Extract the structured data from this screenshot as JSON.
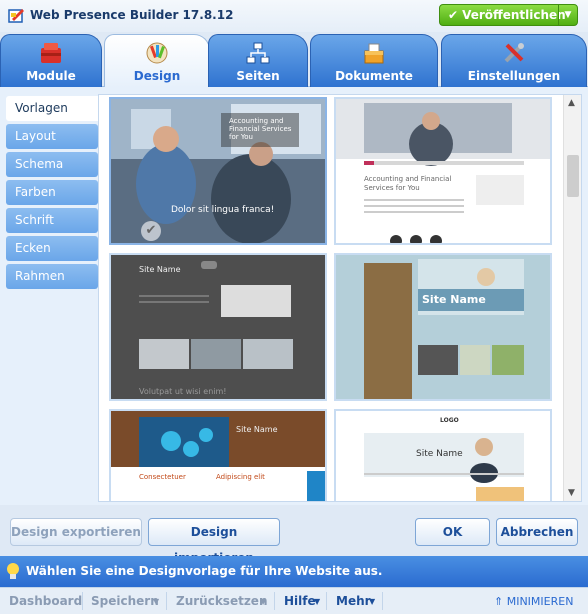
{
  "app": {
    "title": "Web Presence Builder 17.8.12",
    "publish_label": "Veröffentlichen"
  },
  "tabs": [
    {
      "label": "Module",
      "icon": "module-icon",
      "active": false
    },
    {
      "label": "Design",
      "icon": "design-icon",
      "active": true
    },
    {
      "label": "Seiten",
      "icon": "pages-icon",
      "active": false
    },
    {
      "label": "Dokumente",
      "icon": "documents-icon",
      "active": false
    },
    {
      "label": "Einstellungen",
      "icon": "settings-icon",
      "active": false
    }
  ],
  "sidebar": {
    "items": [
      {
        "label": "Vorlagen",
        "active": true
      },
      {
        "label": "Layout",
        "active": false
      },
      {
        "label": "Schema",
        "active": false
      },
      {
        "label": "Farben",
        "active": false
      },
      {
        "label": "Schrift",
        "active": false
      },
      {
        "label": "Ecken",
        "active": false
      },
      {
        "label": "Rahmen",
        "active": false
      }
    ]
  },
  "templates": [
    {
      "text": "Dolor sit lingua franca!",
      "sub": "Accounting and Financial Services for You",
      "selected": true
    },
    {
      "text": "Accounting and Financial Services for You",
      "sub": "",
      "selected": false
    },
    {
      "text": "Site Name",
      "sub": "Volutpat ut wisi enim!",
      "selected": false
    },
    {
      "text": "Site Name",
      "sub": "",
      "selected": false
    },
    {
      "text": "Site Name",
      "sub": "Consectetuer",
      "sub2": "Adipiscing elit",
      "selected": false
    },
    {
      "text": "Site Name",
      "sub": "LOGO",
      "selected": false
    }
  ],
  "buttons": {
    "export": "Design exportieren",
    "import": "Design importieren",
    "ok": "OK",
    "cancel": "Abbrechen"
  },
  "hint": "Wählen Sie eine Designvorlage für Ihre Website aus.",
  "statusbar": {
    "dashboard": "Dashboard",
    "save": "Speichern",
    "reset": "Zurücksetzen",
    "help": "Hilfe",
    "more": "Mehr",
    "minimize": "MINIMIEREN"
  },
  "colors": {
    "accent": "#2f73d0",
    "publish": "#4fae13"
  }
}
